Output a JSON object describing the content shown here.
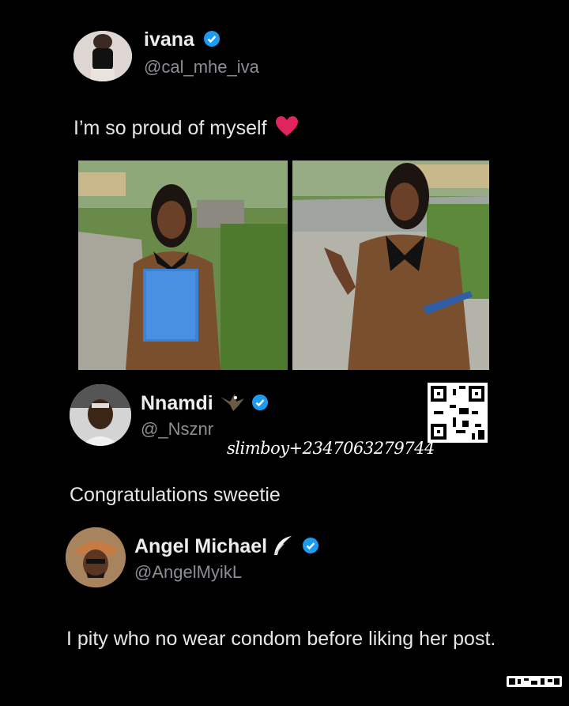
{
  "post": {
    "author": {
      "name": "ivana",
      "handle": "@cal_mhe_iva"
    },
    "text": "I’m so proud of myself",
    "emoji": "heart-emoji"
  },
  "replies": [
    {
      "name": "Nnamdi",
      "handle": "@_Nsznr",
      "text": "Congratulations sweetie",
      "emoji": "eagle-emoji"
    },
    {
      "name": "Angel Michael",
      "handle": "@AngelMyikL",
      "text": "I pity who no wear condom before liking her post.",
      "emoji": "feather-emoji"
    }
  ],
  "watermark": {
    "text": "slimboy+2347063279744"
  },
  "colors": {
    "background": "#000000",
    "verified": "#1d9bf0",
    "heart": "#e0245e"
  }
}
